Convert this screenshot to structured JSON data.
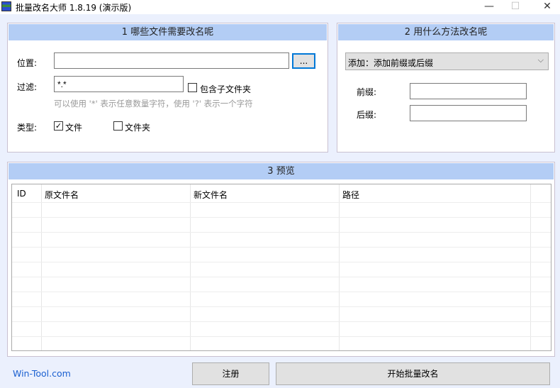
{
  "window": {
    "title": "批量改名大师 1.8.19 (演示版)",
    "minimize": "—",
    "maximize": "☐",
    "close": "✕"
  },
  "panel1": {
    "header": "1 哪些文件需要改名呢",
    "location_label": "位置:",
    "location_value": "",
    "browse_label": "...",
    "filter_label": "过滤:",
    "filter_value": "*.*",
    "include_subfolders_label": "包含子文件夹",
    "include_subfolders_checked": false,
    "hint": "可以使用 '*' 表示任意数量字符，使用 '?' 表示一个字符",
    "type_label": "类型:",
    "type_file_label": "文件",
    "type_file_checked": true,
    "type_folder_label": "文件夹",
    "type_folder_checked": false
  },
  "panel2": {
    "header": "2 用什么方法改名呢",
    "method_selected": "添加：添加前缀或后缀",
    "prefix_label": "前缀:",
    "prefix_value": "",
    "suffix_label": "后缀:",
    "suffix_value": ""
  },
  "panel3": {
    "header": "3 预览",
    "columns": [
      "ID",
      "原文件名",
      "新文件名",
      "路径"
    ]
  },
  "footer": {
    "link": "Win-Tool.com",
    "register": "注册",
    "start": "开始批量改名"
  },
  "colors": {
    "header_bg": "#b3cdf5",
    "link": "#1a5fd0"
  }
}
